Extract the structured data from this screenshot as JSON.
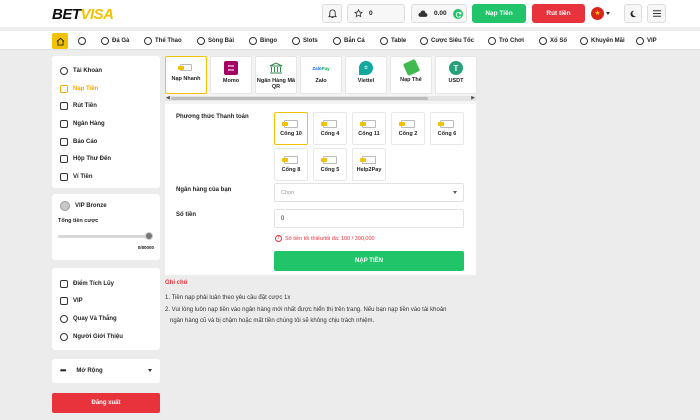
{
  "brand": {
    "part1": "BET",
    "part2": "VISA"
  },
  "header": {
    "points": "0",
    "balance": "0.00",
    "deposit_label": "Nạp Tiền",
    "withdraw_label": "Rút tiền"
  },
  "nav": {
    "items": [
      "Đá Gà",
      "Thể Thao",
      "Sòng Bài",
      "Bingo",
      "Slots",
      "Bắn Cá",
      "Table",
      "Cược Siêu Tốc",
      "Trò Chơi",
      "Xổ Số",
      "Khuyến Mãi",
      "VIP"
    ]
  },
  "sidebar": {
    "account": [
      "Tài Khoản",
      "Nạp Tiền",
      "Rút Tiền",
      "Ngân Hàng",
      "Báo Cáo",
      "Hộp Thư Đến",
      "Ví Tiền"
    ],
    "vip_level": "VIP Bronze",
    "turnover_label": "Tổng tiền cược",
    "turnover_value": "0/80000",
    "rewards": [
      "Điểm Tích Lũy",
      "VIP",
      "Quay Và Thắng",
      "Người Giới Thiệu"
    ],
    "expand_label": "Mở Rộng",
    "logout_label": "Đăng xuất"
  },
  "tabs": [
    {
      "label": "Nạp Nhanh",
      "icon": "card-icon"
    },
    {
      "label": "Momo",
      "icon": "momo-logo"
    },
    {
      "label": "Ngân Hàng Mã QR",
      "icon": "bank-icon"
    },
    {
      "label": "Zalo",
      "icon": "zalopay-logo"
    },
    {
      "label": "Viettel",
      "icon": "viettel-logo"
    },
    {
      "label": "Nạp Thẻ",
      "icon": "phone-card-icon"
    },
    {
      "label": "USDT",
      "icon": "tether-logo"
    }
  ],
  "form": {
    "method_label": "Phương thức Thanh toán",
    "methods": [
      "Cổng 10",
      "Cổng 4",
      "Cổng 11",
      "Cổng 2",
      "Cổng 6",
      "Cổng 8",
      "Cổng 5",
      "Help2Pay"
    ],
    "bank_label": "Ngân hàng của bạn",
    "bank_placeholder": "Chọn",
    "amount_label": "Số tiền",
    "amount_value": "0",
    "limit_text": "Số tiền tối thiểu/tối đa: 100 / 300,000",
    "submit_label": "NẠP TIỀN"
  },
  "notes": {
    "title": "Ghi chú",
    "line1": "1. Tiền nạp phải luân theo yêu cầu đặt cược 1x",
    "line2a": "2. Vui lòng luôn nạp tiền vào ngân hàng mới nhất được hiển thị trên trang. Nếu bạn nạp tiền vào tài khoản",
    "line2b": "ngân hàng cũ và bị chậm hoặc mất tiền chúng tôi sẽ không chịu trách nhiệm."
  },
  "colors": {
    "brand_yellow": "#f2c200",
    "deposit_green": "#22c46a",
    "withdraw_red": "#e8333c"
  }
}
